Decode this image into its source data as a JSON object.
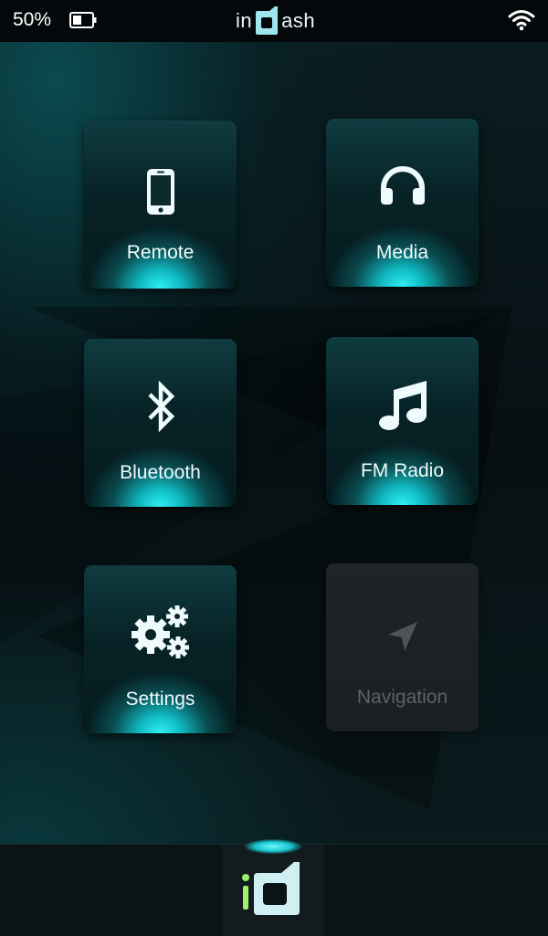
{
  "status_bar": {
    "battery_percent": "50%",
    "battery_level": 0.5,
    "battery_icon": "battery-icon",
    "brand_left": "in",
    "brand_right": "ash",
    "wifi_icon": "wifi-icon"
  },
  "tiles": [
    {
      "label": "Remote",
      "icon": "phone-icon",
      "enabled": true
    },
    {
      "label": "Media",
      "icon": "headphones-icon",
      "enabled": true
    },
    {
      "label": "Bluetooth",
      "icon": "bluetooth-icon",
      "enabled": true
    },
    {
      "label": "FM Radio",
      "icon": "music-note-icon",
      "enabled": true
    },
    {
      "label": "Settings",
      "icon": "gears-icon",
      "enabled": true
    },
    {
      "label": "Navigation",
      "icon": "navigation-arrow-icon",
      "enabled": false
    }
  ],
  "dock": {
    "home_icon": "indash-logo-icon"
  },
  "colors": {
    "accent": "#2ff1f6",
    "tile_base": "#072226",
    "disabled_tile": "#1f2527",
    "disabled_text": "#5b6366"
  }
}
